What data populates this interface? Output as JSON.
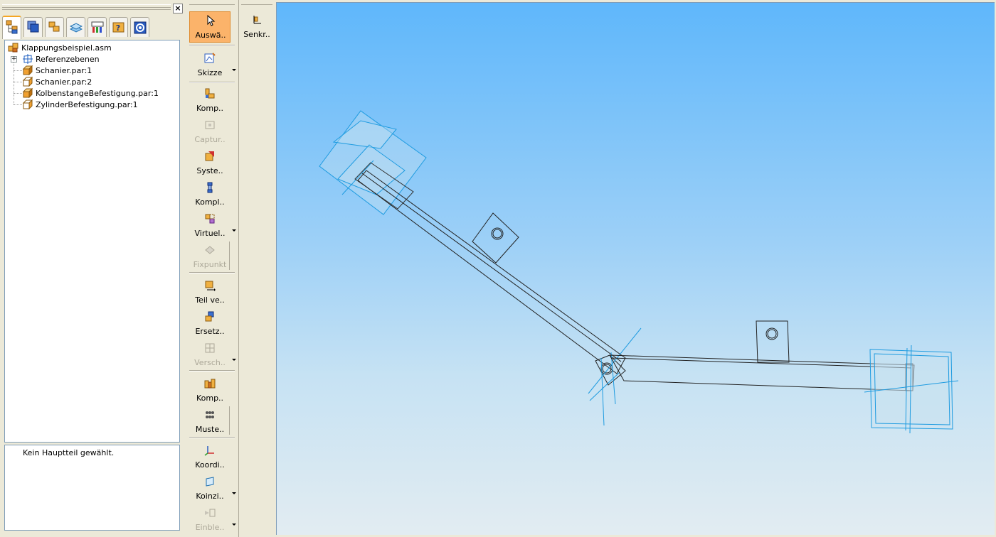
{
  "panel": {
    "close_label": "×",
    "tabs": [
      {
        "icon": "assembly-tree-icon",
        "active": true
      },
      {
        "icon": "layers-stack-icon"
      },
      {
        "icon": "parts-library-icon"
      },
      {
        "icon": "layer-sheets-icon"
      },
      {
        "icon": "display-config-icon"
      },
      {
        "icon": "help-faq-icon"
      },
      {
        "icon": "settings-gear-icon"
      }
    ]
  },
  "tree": {
    "root": "Klappungsbeispiel.asm",
    "items": [
      {
        "label": "Referenzebenen",
        "icon": "reference-planes-icon",
        "expandable": true
      },
      {
        "label": "Schanier.par:1",
        "icon": "part-icon"
      },
      {
        "label": "Schanier.par:2",
        "icon": "part-icon"
      },
      {
        "label": "KolbenstangeBefestigung.par:1",
        "icon": "part-icon"
      },
      {
        "label": "ZylinderBefestigung.par:1",
        "icon": "part-icon"
      }
    ],
    "expander_label": "+"
  },
  "status": {
    "text": "Kein Hauptteil gewählt."
  },
  "toolbar": {
    "tools": [
      {
        "label": "Auswä..",
        "icon": "cursor-arrow-icon",
        "active": true
      },
      {
        "label": "Skizze",
        "icon": "sketch-icon",
        "dropdown": true
      },
      {
        "label": "Komp..",
        "icon": "component-icon"
      },
      {
        "label": "Captur..",
        "icon": "capture-icon",
        "disabled": true
      },
      {
        "label": "Syste..",
        "icon": "system-library-icon"
      },
      {
        "label": "Kompl..",
        "icon": "complex-part-icon"
      },
      {
        "label": "Virtuel..",
        "icon": "virtual-component-icon",
        "dropdown": true
      },
      {
        "label": "Fixpunkt",
        "icon": "fixpoint-icon",
        "disabled": true
      },
      {
        "label": "Teil ve..",
        "icon": "move-part-icon"
      },
      {
        "label": "Ersetz..",
        "icon": "replace-part-icon"
      },
      {
        "label": "Versch..",
        "icon": "shift-icon",
        "disabled": true,
        "dropdown": true
      },
      {
        "label": "Komp..",
        "icon": "component-folder-icon"
      },
      {
        "label": "Muste..",
        "icon": "pattern-icon"
      },
      {
        "label": "Koordi..",
        "icon": "coordinate-system-icon"
      },
      {
        "label": "Koinzi..",
        "icon": "coincident-plane-icon",
        "dropdown": true
      },
      {
        "label": "Einble..",
        "icon": "show-hide-icon",
        "disabled": true,
        "dropdown": true
      }
    ]
  },
  "toolbar2": {
    "tools": [
      {
        "label": "Senkr..",
        "icon": "perpendicular-icon"
      }
    ]
  },
  "colors": {
    "viewport_top": "#5fb7fb",
    "viewport_bottom": "#e2ecf2",
    "plane_blue": "#1e9be0",
    "active_tool": "#fbb36a"
  }
}
